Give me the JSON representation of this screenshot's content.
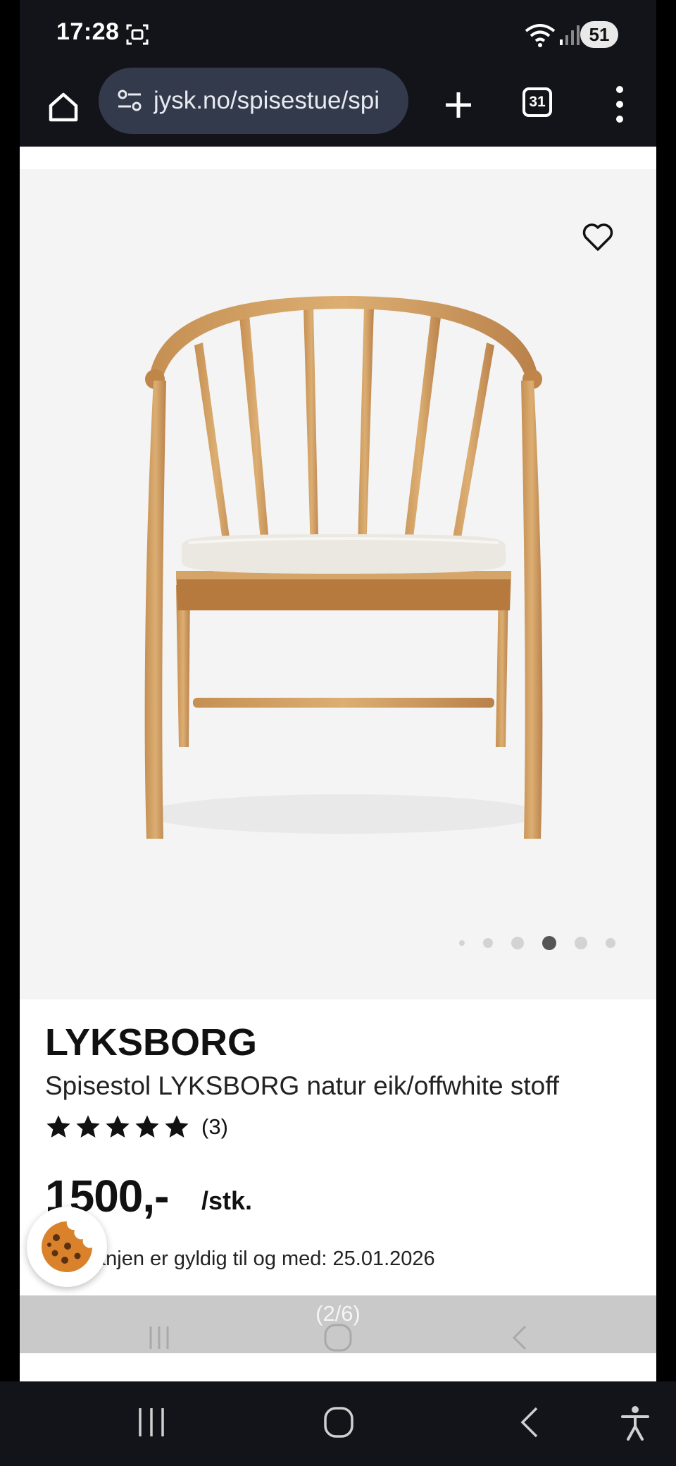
{
  "status_bar": {
    "time": "17:28",
    "battery": "51"
  },
  "browser": {
    "url": "jysk.no/spisestue/spi",
    "tab_count": "31"
  },
  "gallery": {
    "active_index": 3,
    "dot_count": 6,
    "counter_text": "(2/6)"
  },
  "product": {
    "brand": "LYKSBORG",
    "name": "Spisestol LYKSBORG natur eik/offwhite stoff",
    "rating_stars": 5,
    "review_count": "(3)",
    "price": "1500,-",
    "unit": "/stk.",
    "validity": "anjen er gyldig til og med: 25.01.2026"
  },
  "colors": {
    "star": "#111111",
    "cookie": "#d9822b",
    "toolbar": "#13141a",
    "url_pill": "#333a4c"
  },
  "icons": [
    "home-icon",
    "tune-icon",
    "plus-icon",
    "tabs-icon",
    "more-vert-icon",
    "heart-icon",
    "star-icon",
    "cookie-icon",
    "recent-apps-icon",
    "home-circle-icon",
    "back-icon",
    "accessibility-icon"
  ]
}
